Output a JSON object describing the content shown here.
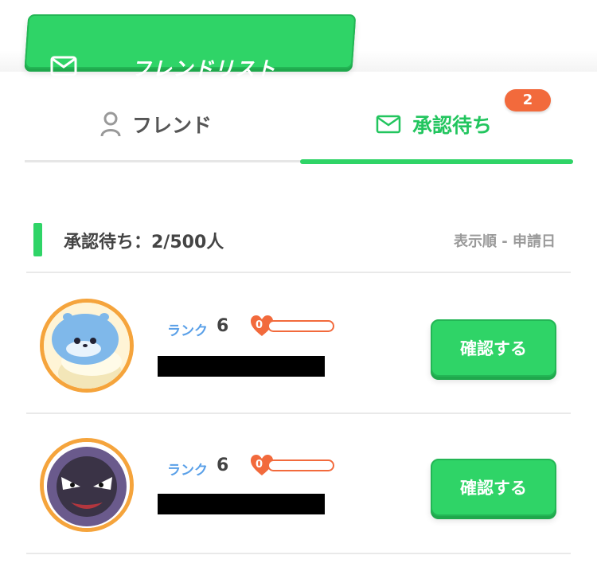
{
  "header": {
    "title": "フレンドリスト",
    "icon": "mail-icon"
  },
  "tabs": [
    {
      "label": "フレンド",
      "icon": "person-icon",
      "active": false
    },
    {
      "label": "承認待ち",
      "icon": "mail-icon",
      "active": true,
      "badge": "2"
    }
  ],
  "section": {
    "title": "承認待ち：2/500人",
    "sort_label": "表示順 - 申請日"
  },
  "requests": [
    {
      "rank_label": "ランク",
      "rank": "6",
      "friendship_level": "0",
      "friendship_progress": 0,
      "button_label": "確認する",
      "avatar": "spheal-avatar"
    },
    {
      "rank_label": "ランク",
      "rank": "6",
      "friendship_level": "0",
      "friendship_progress": 0,
      "button_label": "確認する",
      "avatar": "gastly-avatar"
    }
  ],
  "colors": {
    "accent": "#2fd467",
    "badge": "#f26a3c",
    "rank": "#5aa0e8"
  }
}
